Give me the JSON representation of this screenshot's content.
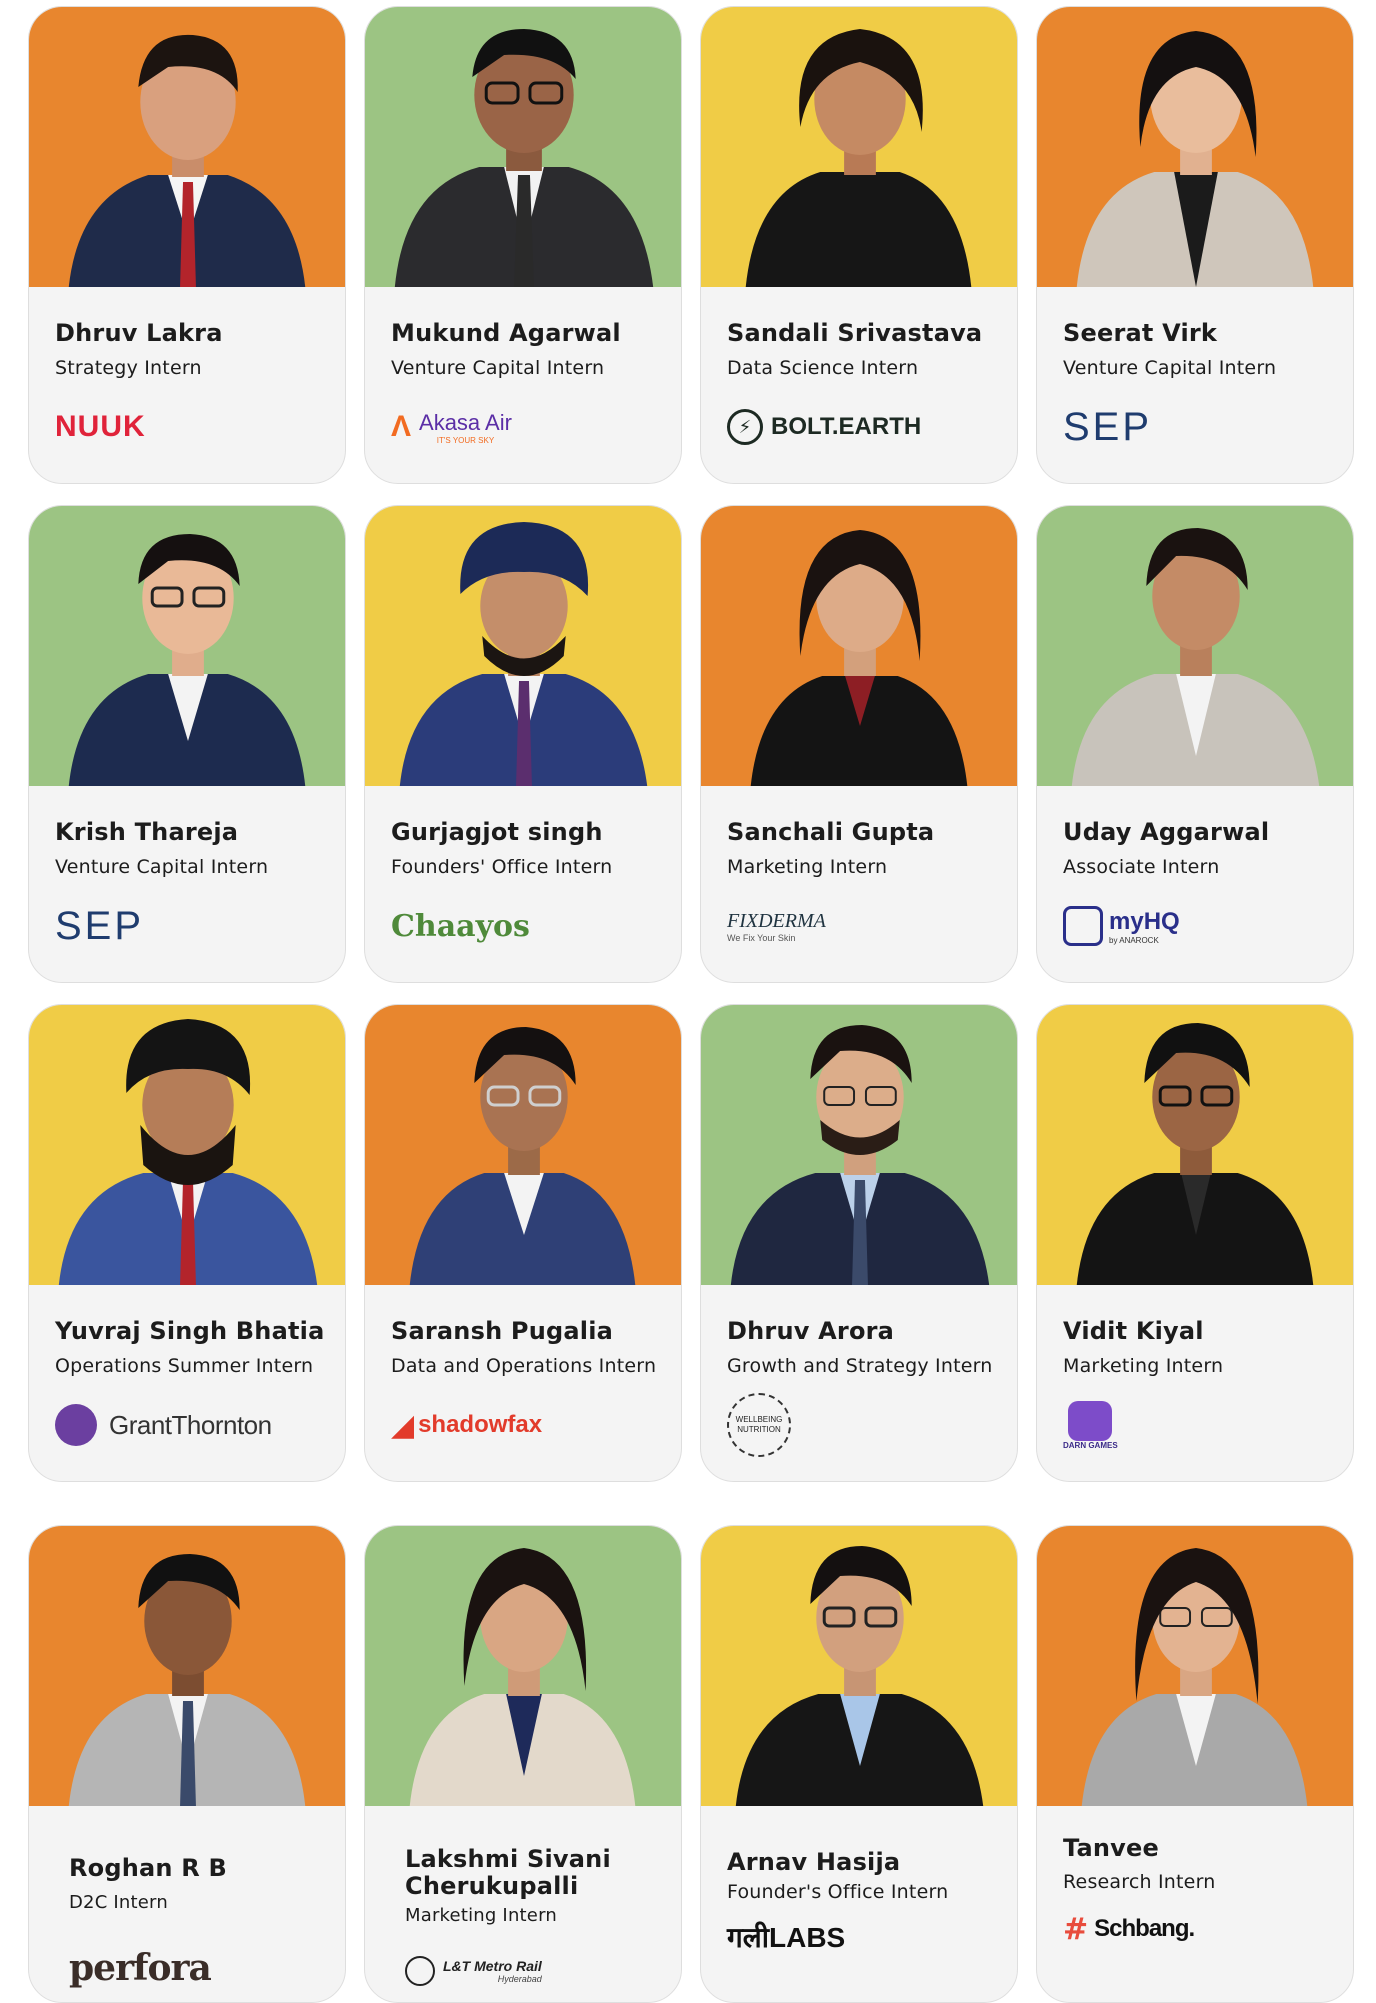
{
  "colors": {
    "orange": "#e8862e",
    "green": "#9cc483",
    "yellow": "#f0cc46"
  },
  "people": [
    {
      "name": "Dhruv Lakra",
      "role": "Strategy Intern",
      "company": "NUUK",
      "bg": "orange",
      "logo": "nuuk-logo"
    },
    {
      "name": "Mukund Agarwal",
      "role": "Venture Capital Intern",
      "company": "Akasa Air",
      "tagline": "IT'S YOUR SKY",
      "bg": "green",
      "logo": "akasa-air-logo"
    },
    {
      "name": "Sandali Srivastava",
      "role": "Data Science Intern",
      "company": "BOLT.EARTH",
      "bg": "yellow",
      "logo": "bolt-earth-logo"
    },
    {
      "name": "Seerat Virk",
      "role": "Venture Capital Intern",
      "company": "SEP",
      "bg": "orange",
      "logo": "sep-logo"
    },
    {
      "name": "Krish Thareja",
      "role": "Venture Capital Intern",
      "company": "SEP",
      "bg": "green",
      "logo": "sep-logo"
    },
    {
      "name": "Gurjagjot singh",
      "role": "Founders' Office Intern",
      "company": "Chaayos",
      "bg": "yellow",
      "logo": "chaayos-logo"
    },
    {
      "name": "Sanchali Gupta",
      "role": "Marketing Intern",
      "company": "FIXDERMA",
      "tagline": "We Fix Your Skin",
      "bg": "orange",
      "logo": "fixderma-logo"
    },
    {
      "name": "Uday Aggarwal",
      "role": "Associate Intern",
      "company": "myHQ",
      "tagline": "by ANAROCK",
      "bg": "green",
      "logo": "myhq-logo"
    },
    {
      "name": "Yuvraj Singh Bhatia",
      "role": "Operations Summer Intern",
      "company": "GrantThornton",
      "bg": "yellow",
      "logo": "grant-thornton-logo"
    },
    {
      "name": "Saransh Pugalia",
      "role": "Data and Operations Intern",
      "company": "shadowfax",
      "bg": "orange",
      "logo": "shadowfax-logo"
    },
    {
      "name": "Dhruv Arora",
      "role": "Growth and Strategy Intern",
      "company": "WELLBEING NUTRITION",
      "bg": "green",
      "logo": "wellbeing-nutrition-logo"
    },
    {
      "name": "Vidit Kiyal",
      "role": "Marketing Intern",
      "company": "DARN GAMES",
      "bg": "yellow",
      "logo": "darn-games-logo"
    },
    {
      "name": "Roghan R B",
      "role": "D2C Intern",
      "company": "perfora",
      "bg": "orange",
      "logo": "perfora-logo"
    },
    {
      "name": "Lakshmi Sivani Cherukupalli",
      "role": "Marketing Intern",
      "company": "L&T Metro Rail",
      "tagline": "Hyderabad",
      "bg": "green",
      "logo": "lt-metro-logo"
    },
    {
      "name": "Arnav Hasija",
      "role": "Founder's Office Intern",
      "company": "गलीLABS",
      "bg": "yellow",
      "logo": "gali-labs-logo"
    },
    {
      "name": "Tanvee",
      "role": "Research Intern",
      "company": "Schbang.",
      "bg": "orange",
      "logo": "schbang-logo"
    }
  ]
}
